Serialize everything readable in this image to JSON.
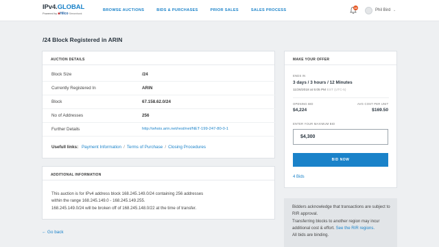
{
  "brand": {
    "name_main": "IPv4.",
    "name_accent": "GLOBAL",
    "powered_by": "Powered by",
    "partner": "Hilco",
    "partner_sub": "Streambank"
  },
  "nav": {
    "items": [
      "BROWSE AUCTIONS",
      "BIDS & PURCHASES",
      "PRIOR SALES",
      "SALES PROCESS"
    ]
  },
  "header": {
    "notification_count": "10",
    "user_name": "Phil Bird"
  },
  "page": {
    "title": "/24 Block Registered in ARIN",
    "back_label": "Go back"
  },
  "auction_details": {
    "heading": "AUCTION DETAILS",
    "rows": [
      {
        "label": "Block Size",
        "value": "/24"
      },
      {
        "label": "Currently Registered In",
        "value": "ARIN"
      },
      {
        "label": "Block",
        "value": "67.158.62.0/24"
      },
      {
        "label": "No of Addresses",
        "value": "256"
      },
      {
        "label": "Further Details",
        "value": "http://whois.arin.net/rest/net/NET-199-247-80-0-1"
      }
    ],
    "useful_label": "Usefull links:",
    "links": [
      "Payment Information",
      "Terms of Purchase",
      "Closing Procedures"
    ]
  },
  "additional_info": {
    "heading": "ADDITIONAL INFORMATION",
    "lines": [
      "This auction is for IPv4 address block 168.245.149.0/24 containing 256 addresses",
      "within the range 168.245.149.0 - 168.245.149.255.",
      "168.245.149.0/24 will be broken off of 168.245.148.0/22 at the time of transfer."
    ]
  },
  "offer": {
    "heading": "MAKE YOUR OFFER",
    "ends_label": "ENDS IN",
    "ends_value": "3 days / 3 hours / 12 Minutes",
    "ends_date": "11/26/2018 at 5:05 PM",
    "ends_tz": "EST (UTC-5)",
    "opening_label": "OPENING BID",
    "opening_value": "$4,224",
    "avg_label": "AVG COST PER UNIT",
    "avg_value": "$169.50",
    "max_label": "ENTER YOUR MAXIMUM BID",
    "max_value": "$4,300",
    "button_label": "BID NOW",
    "bids_count": "4 Bids"
  },
  "notice": {
    "text1": "Bidders acknowledge that transactions are subject to RIR approval.",
    "text2": "Transferring blocks to another region may incur additional cost & effort.",
    "link": "See the RIR regions.",
    "text3": "All bids are binding."
  },
  "colors": {
    "accent": "#1a82c9",
    "badge": "#e5541f",
    "background": "#eef0f2"
  }
}
